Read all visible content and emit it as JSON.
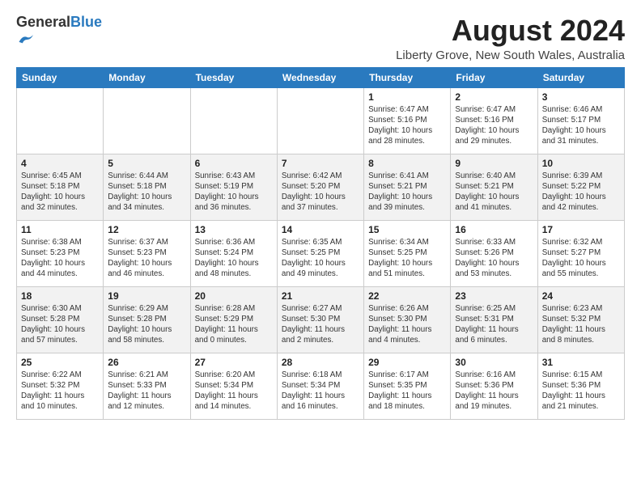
{
  "logo": {
    "general": "General",
    "blue": "Blue"
  },
  "header": {
    "title": "August 2024",
    "subtitle": "Liberty Grove, New South Wales, Australia"
  },
  "columns": [
    "Sunday",
    "Monday",
    "Tuesday",
    "Wednesday",
    "Thursday",
    "Friday",
    "Saturday"
  ],
  "weeks": [
    [
      {
        "date": "",
        "sunrise": "",
        "sunset": "",
        "daylight": "",
        "empty": true
      },
      {
        "date": "",
        "sunrise": "",
        "sunset": "",
        "daylight": "",
        "empty": true
      },
      {
        "date": "",
        "sunrise": "",
        "sunset": "",
        "daylight": "",
        "empty": true
      },
      {
        "date": "",
        "sunrise": "",
        "sunset": "",
        "daylight": "",
        "empty": true
      },
      {
        "date": "1",
        "sunrise": "Sunrise: 6:47 AM",
        "sunset": "Sunset: 5:16 PM",
        "daylight": "Daylight: 10 hours and 28 minutes."
      },
      {
        "date": "2",
        "sunrise": "Sunrise: 6:47 AM",
        "sunset": "Sunset: 5:16 PM",
        "daylight": "Daylight: 10 hours and 29 minutes."
      },
      {
        "date": "3",
        "sunrise": "Sunrise: 6:46 AM",
        "sunset": "Sunset: 5:17 PM",
        "daylight": "Daylight: 10 hours and 31 minutes."
      }
    ],
    [
      {
        "date": "4",
        "sunrise": "Sunrise: 6:45 AM",
        "sunset": "Sunset: 5:18 PM",
        "daylight": "Daylight: 10 hours and 32 minutes."
      },
      {
        "date": "5",
        "sunrise": "Sunrise: 6:44 AM",
        "sunset": "Sunset: 5:18 PM",
        "daylight": "Daylight: 10 hours and 34 minutes."
      },
      {
        "date": "6",
        "sunrise": "Sunrise: 6:43 AM",
        "sunset": "Sunset: 5:19 PM",
        "daylight": "Daylight: 10 hours and 36 minutes."
      },
      {
        "date": "7",
        "sunrise": "Sunrise: 6:42 AM",
        "sunset": "Sunset: 5:20 PM",
        "daylight": "Daylight: 10 hours and 37 minutes."
      },
      {
        "date": "8",
        "sunrise": "Sunrise: 6:41 AM",
        "sunset": "Sunset: 5:21 PM",
        "daylight": "Daylight: 10 hours and 39 minutes."
      },
      {
        "date": "9",
        "sunrise": "Sunrise: 6:40 AM",
        "sunset": "Sunset: 5:21 PM",
        "daylight": "Daylight: 10 hours and 41 minutes."
      },
      {
        "date": "10",
        "sunrise": "Sunrise: 6:39 AM",
        "sunset": "Sunset: 5:22 PM",
        "daylight": "Daylight: 10 hours and 42 minutes."
      }
    ],
    [
      {
        "date": "11",
        "sunrise": "Sunrise: 6:38 AM",
        "sunset": "Sunset: 5:23 PM",
        "daylight": "Daylight: 10 hours and 44 minutes."
      },
      {
        "date": "12",
        "sunrise": "Sunrise: 6:37 AM",
        "sunset": "Sunset: 5:23 PM",
        "daylight": "Daylight: 10 hours and 46 minutes."
      },
      {
        "date": "13",
        "sunrise": "Sunrise: 6:36 AM",
        "sunset": "Sunset: 5:24 PM",
        "daylight": "Daylight: 10 hours and 48 minutes."
      },
      {
        "date": "14",
        "sunrise": "Sunrise: 6:35 AM",
        "sunset": "Sunset: 5:25 PM",
        "daylight": "Daylight: 10 hours and 49 minutes."
      },
      {
        "date": "15",
        "sunrise": "Sunrise: 6:34 AM",
        "sunset": "Sunset: 5:25 PM",
        "daylight": "Daylight: 10 hours and 51 minutes."
      },
      {
        "date": "16",
        "sunrise": "Sunrise: 6:33 AM",
        "sunset": "Sunset: 5:26 PM",
        "daylight": "Daylight: 10 hours and 53 minutes."
      },
      {
        "date": "17",
        "sunrise": "Sunrise: 6:32 AM",
        "sunset": "Sunset: 5:27 PM",
        "daylight": "Daylight: 10 hours and 55 minutes."
      }
    ],
    [
      {
        "date": "18",
        "sunrise": "Sunrise: 6:30 AM",
        "sunset": "Sunset: 5:28 PM",
        "daylight": "Daylight: 10 hours and 57 minutes."
      },
      {
        "date": "19",
        "sunrise": "Sunrise: 6:29 AM",
        "sunset": "Sunset: 5:28 PM",
        "daylight": "Daylight: 10 hours and 58 minutes."
      },
      {
        "date": "20",
        "sunrise": "Sunrise: 6:28 AM",
        "sunset": "Sunset: 5:29 PM",
        "daylight": "Daylight: 11 hours and 0 minutes."
      },
      {
        "date": "21",
        "sunrise": "Sunrise: 6:27 AM",
        "sunset": "Sunset: 5:30 PM",
        "daylight": "Daylight: 11 hours and 2 minutes."
      },
      {
        "date": "22",
        "sunrise": "Sunrise: 6:26 AM",
        "sunset": "Sunset: 5:30 PM",
        "daylight": "Daylight: 11 hours and 4 minutes."
      },
      {
        "date": "23",
        "sunrise": "Sunrise: 6:25 AM",
        "sunset": "Sunset: 5:31 PM",
        "daylight": "Daylight: 11 hours and 6 minutes."
      },
      {
        "date": "24",
        "sunrise": "Sunrise: 6:23 AM",
        "sunset": "Sunset: 5:32 PM",
        "daylight": "Daylight: 11 hours and 8 minutes."
      }
    ],
    [
      {
        "date": "25",
        "sunrise": "Sunrise: 6:22 AM",
        "sunset": "Sunset: 5:32 PM",
        "daylight": "Daylight: 11 hours and 10 minutes."
      },
      {
        "date": "26",
        "sunrise": "Sunrise: 6:21 AM",
        "sunset": "Sunset: 5:33 PM",
        "daylight": "Daylight: 11 hours and 12 minutes."
      },
      {
        "date": "27",
        "sunrise": "Sunrise: 6:20 AM",
        "sunset": "Sunset: 5:34 PM",
        "daylight": "Daylight: 11 hours and 14 minutes."
      },
      {
        "date": "28",
        "sunrise": "Sunrise: 6:18 AM",
        "sunset": "Sunset: 5:34 PM",
        "daylight": "Daylight: 11 hours and 16 minutes."
      },
      {
        "date": "29",
        "sunrise": "Sunrise: 6:17 AM",
        "sunset": "Sunset: 5:35 PM",
        "daylight": "Daylight: 11 hours and 18 minutes."
      },
      {
        "date": "30",
        "sunrise": "Sunrise: 6:16 AM",
        "sunset": "Sunset: 5:36 PM",
        "daylight": "Daylight: 11 hours and 19 minutes."
      },
      {
        "date": "31",
        "sunrise": "Sunrise: 6:15 AM",
        "sunset": "Sunset: 5:36 PM",
        "daylight": "Daylight: 11 hours and 21 minutes."
      }
    ]
  ]
}
